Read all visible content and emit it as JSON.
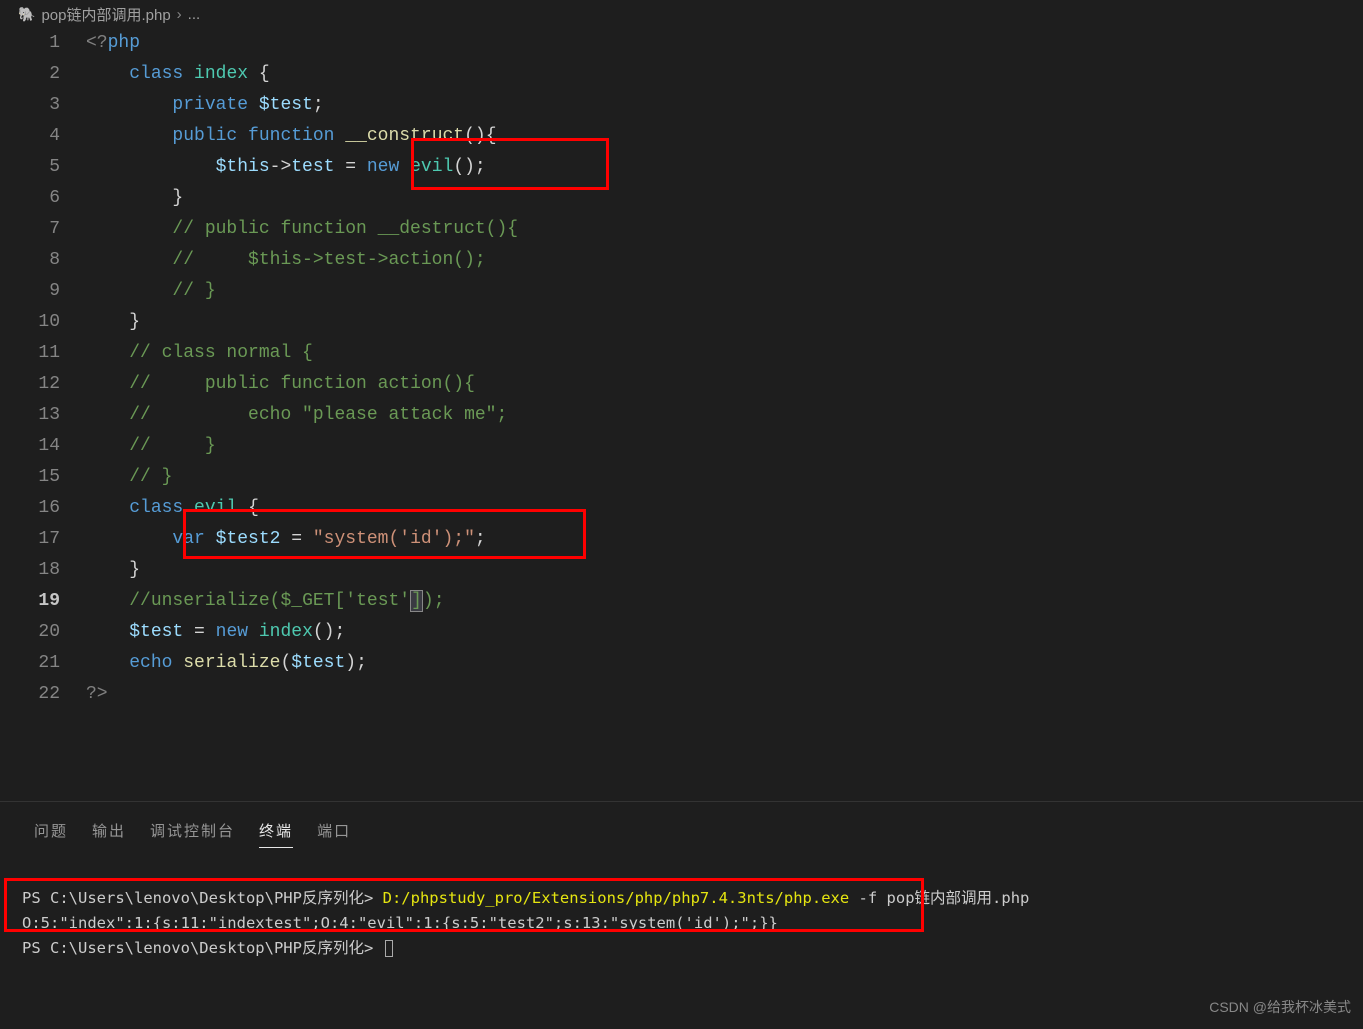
{
  "breadcrumb": {
    "file": "pop链内部调用.php",
    "more": "..."
  },
  "lines": [
    1,
    2,
    3,
    4,
    5,
    6,
    7,
    8,
    9,
    10,
    11,
    12,
    13,
    14,
    15,
    16,
    17,
    18,
    19,
    20,
    21,
    22
  ],
  "current_line": 19,
  "code": {
    "l1": {
      "open": "<?",
      "php": "php"
    },
    "l2": {
      "kw1": "class",
      "cls": "index",
      "br": "{"
    },
    "l3": {
      "kw1": "private",
      "var": "$test",
      "sc": ";"
    },
    "l4": {
      "kw1": "public",
      "kw2": "function",
      "fn": "__construct",
      "par": "()",
      "br": "{"
    },
    "l5": {
      "var": "$this",
      "arrow": "->",
      "prop": "test",
      "eq": " = ",
      "new": "new",
      "cls": "evil",
      "call": "()",
      "sc": ";"
    },
    "l6": {
      "br": "}"
    },
    "l7": {
      "cmt": "// public function __destruct(){"
    },
    "l8": {
      "cmt": "//     $this->test->action();"
    },
    "l9": {
      "cmt": "// }"
    },
    "l10": {
      "br": "}"
    },
    "l11": {
      "cmt": "// class normal {"
    },
    "l12": {
      "cmt": "//     public function action(){"
    },
    "l13": {
      "cmt": "//         echo \"please attack me\";"
    },
    "l14": {
      "cmt": "//     }"
    },
    "l15": {
      "cmt": "// }"
    },
    "l16": {
      "kw1": "class",
      "cls": "evil",
      "br": "{"
    },
    "l17": {
      "kw1": "var",
      "var": "$test2",
      "eq": " = ",
      "str": "\"system('id');\"",
      "sc": ";"
    },
    "l18": {
      "br": "}"
    },
    "l19": {
      "cmt1": "//",
      "cmt2": "unserialize",
      "cmt3": "(",
      "cmt4": "$_GET",
      "cmt5": "[",
      "cmt6": "'test'",
      "cmt7": "]",
      "cmt8": ")",
      "cmt9": ";"
    },
    "l20": {
      "var": "$test",
      "eq": " = ",
      "new": "new",
      "cls": "index",
      "call": "()",
      "sc": ";"
    },
    "l21": {
      "kw": "echo",
      "fn": "serialize",
      "lp": "(",
      "var": "$test",
      "rp": ")",
      "sc": ";"
    },
    "l22": {
      "close": "?>"
    }
  },
  "panel": {
    "tabs": {
      "problems": "问题",
      "output": "输出",
      "debug": "调试控制台",
      "terminal": "终端",
      "ports": "端口"
    },
    "term": {
      "prompt1": "PS C:\\Users\\lenovo\\Desktop\\PHP反序列化> ",
      "cmd": "D:/phpstudy_pro/Extensions/php/php7.4.3nts/php.exe",
      "args": " -f pop链内部调用.php",
      "out": "O:5:\"index\":1:{s:11:\"indextest\";O:4:\"evil\":1:{s:5:\"test2\";s:13:\"system('id');\";}}",
      "prompt2": "PS C:\\Users\\lenovo\\Desktop\\PHP反序列化> "
    }
  },
  "watermark": "CSDN @给我杯冰美式"
}
